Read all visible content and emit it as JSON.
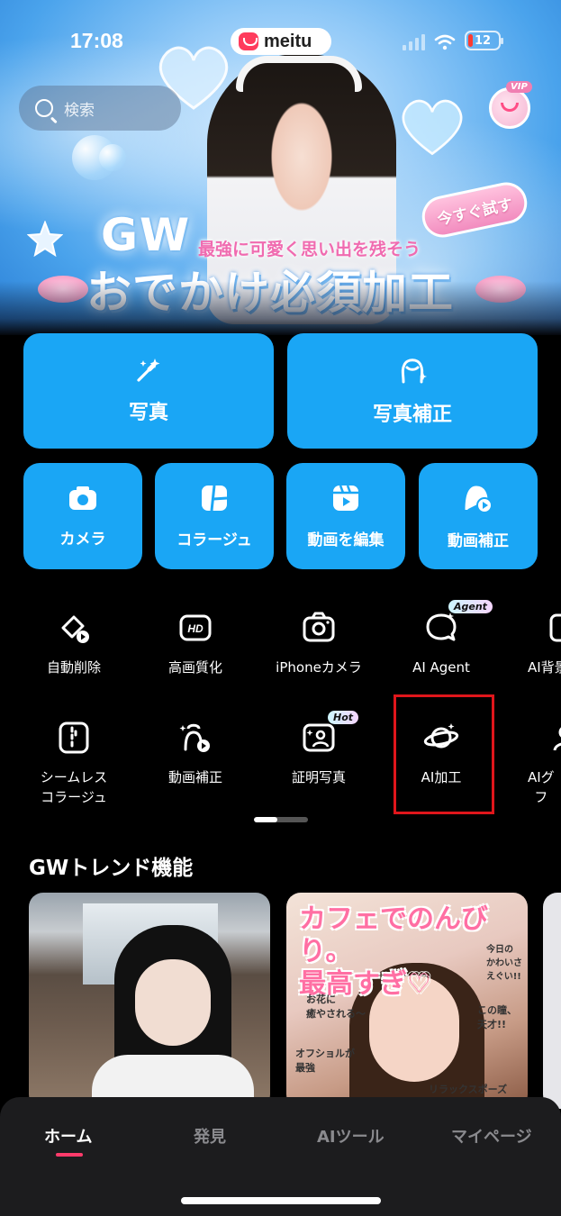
{
  "status_bar": {
    "time": "17:08",
    "battery": "12"
  },
  "app": {
    "logo": "meitu"
  },
  "search": {
    "placeholder": "検索"
  },
  "vip": {
    "tag": "VIP"
  },
  "banner": {
    "title_line1": "GW",
    "subtitle": "最強に可愛く思い出を残そう",
    "title_line2": "おでかけ必須加工",
    "cta": "今すぐ試す"
  },
  "primary_tiles": [
    {
      "label": "写真",
      "icon": "magic-wand-icon"
    },
    {
      "label": "写真補正",
      "icon": "face-outline-icon"
    }
  ],
  "secondary_tiles": [
    {
      "label": "カメラ",
      "icon": "camera-icon"
    },
    {
      "label": "コラージュ",
      "icon": "collage-icon"
    },
    {
      "label": "動画を編集",
      "icon": "video-edit-icon"
    },
    {
      "label": "動画補正",
      "icon": "video-face-icon"
    }
  ],
  "tools_row1": [
    {
      "label": "自動削除",
      "icon": "eraser-icon"
    },
    {
      "label": "高画質化",
      "icon": "hd-icon"
    },
    {
      "label": "iPhoneカメラ",
      "icon": "iphone-camera-icon"
    },
    {
      "label": "AI Agent",
      "icon": "chat-bubble-icon",
      "tag": "Agent"
    },
    {
      "label": "AI背景",
      "icon": "ai-background-icon"
    }
  ],
  "tools_row2": [
    {
      "label": "シームレス\nコラージュ",
      "icon": "seamless-collage-icon"
    },
    {
      "label": "動画補正",
      "icon": "video-retouch-icon"
    },
    {
      "label": "証明写真",
      "icon": "id-photo-icon",
      "tag": "Hot"
    },
    {
      "label": "AI加工",
      "icon": "planet-icon"
    },
    {
      "label": "AIグ\nフ",
      "icon": "ai-group-icon"
    }
  ],
  "section": {
    "title": "GWトレンド機能"
  },
  "cards": {
    "card2_title": "カフェでのんびり。\n最高すぎ♡",
    "card2_notes": [
      "お花に\n癒やされる〜",
      "オフショルが\n最強",
      "今日の\nかわいさ\nえぐい!!",
      "この瞳、\n天才!!",
      "リラックスポーズ"
    ]
  },
  "tabs": [
    {
      "label": "ホーム",
      "active": true
    },
    {
      "label": "発見",
      "active": false
    },
    {
      "label": "AIツール",
      "active": false
    },
    {
      "label": "マイページ",
      "active": false
    }
  ],
  "colors": {
    "tile_blue": "#1aa6f5",
    "accent_pink": "#ff3b6b",
    "highlight_red": "#e0161b"
  }
}
